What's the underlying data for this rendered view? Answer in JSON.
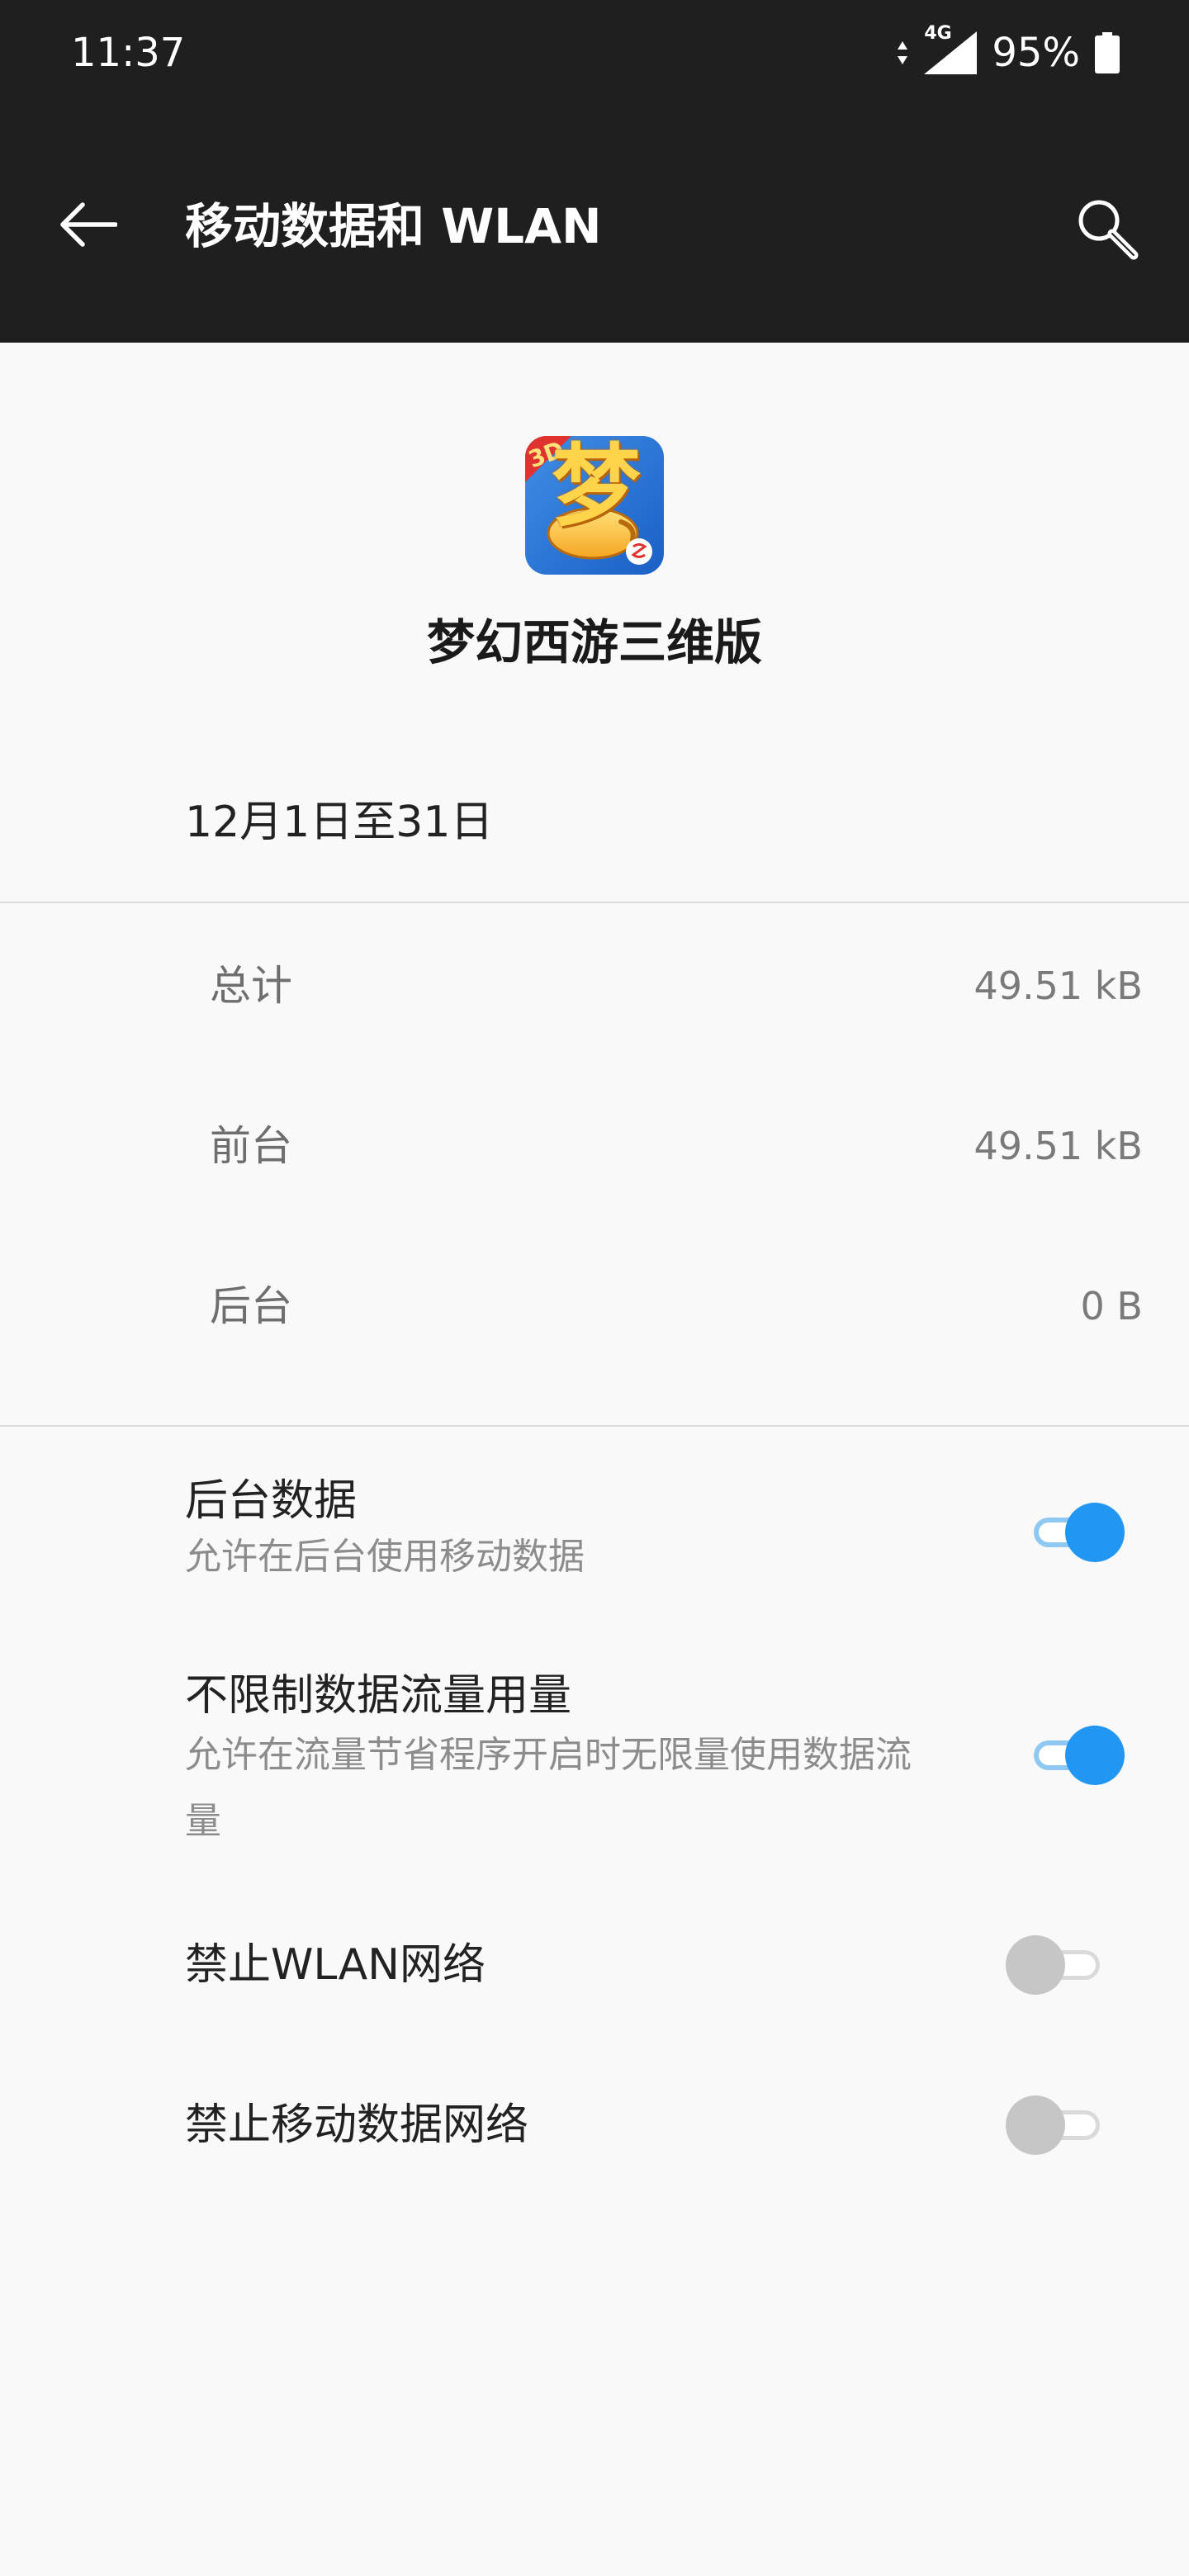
{
  "status_bar": {
    "time": "11:37",
    "network_type": "4G",
    "battery_percent": "95%",
    "battery_level": 0.95
  },
  "app_bar": {
    "title": "移动数据和 WLAN",
    "back_icon": "arrow-left-icon",
    "search_icon": "search-icon"
  },
  "app": {
    "name": "梦幻西游三维版",
    "icon": "app-icon-menghuan",
    "icon_badge": "3D",
    "icon_glyph": "梦"
  },
  "cycle": {
    "date_range": "12月1日至31日"
  },
  "usage": [
    {
      "label": "总计",
      "value": "49.51 kB"
    },
    {
      "label": "前台",
      "value": "49.51 kB"
    },
    {
      "label": "后台",
      "value": "0 B"
    }
  ],
  "settings": {
    "background_data": {
      "title": "后台数据",
      "summary": "允许在后台使用移动数据",
      "enabled": true
    },
    "unrestricted_data": {
      "title": "不限制数据流量用量",
      "summary": "允许在流量节省程序开启时无限量使用数据流量",
      "enabled": true
    },
    "disable_wlan": {
      "title": "禁止WLAN网络",
      "enabled": false
    },
    "disable_mobile": {
      "title": "禁止移动数据网络",
      "enabled": false
    }
  },
  "colors": {
    "toolbar_bg": "#1f1f1f",
    "page_bg": "#f9f9f9",
    "accent": "#2196f3",
    "accent_track": "#8ec8f3",
    "switch_off_thumb": "#c6c6c6"
  }
}
